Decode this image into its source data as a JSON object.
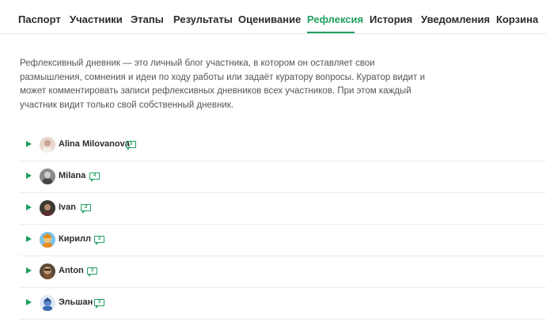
{
  "tabs": [
    {
      "label": "Паспорт"
    },
    {
      "label": "Участники"
    },
    {
      "label": "Этапы"
    },
    {
      "label": "Результаты"
    },
    {
      "label": "Оценивание"
    },
    {
      "label": "Рефлексия"
    },
    {
      "label": "История"
    },
    {
      "label": "Уведомления"
    },
    {
      "label": "Корзина"
    }
  ],
  "active_tab": "Рефлексия",
  "description": "Рефлексивный дневник — это личный блог участника, в котором он оставляет свои размышления, сомнения и идеи по ходу работы или задаёт куратору вопросы. Куратор видит и может комментировать записи рефлексивных дневников всех участников. При этом каждый участник видит только свой собственный дневник.",
  "participants": [
    {
      "name": "Alina Milovanova",
      "comments": "3",
      "avatar": "avatar-alina"
    },
    {
      "name": "Milana",
      "comments": "4",
      "avatar": "avatar-milana"
    },
    {
      "name": "Ivan",
      "comments": "2",
      "avatar": "avatar-ivan"
    },
    {
      "name": "Кирилл",
      "comments": "3",
      "avatar": "avatar-kirill"
    },
    {
      "name": "Anton",
      "comments": "3",
      "avatar": "avatar-anton"
    },
    {
      "name": "Эльшан",
      "comments": "3",
      "avatar": "avatar-elshan"
    }
  ],
  "colors": {
    "accent": "#1fa060",
    "text": "#2b2b2b",
    "muted": "#555555",
    "divider": "#ececec"
  }
}
